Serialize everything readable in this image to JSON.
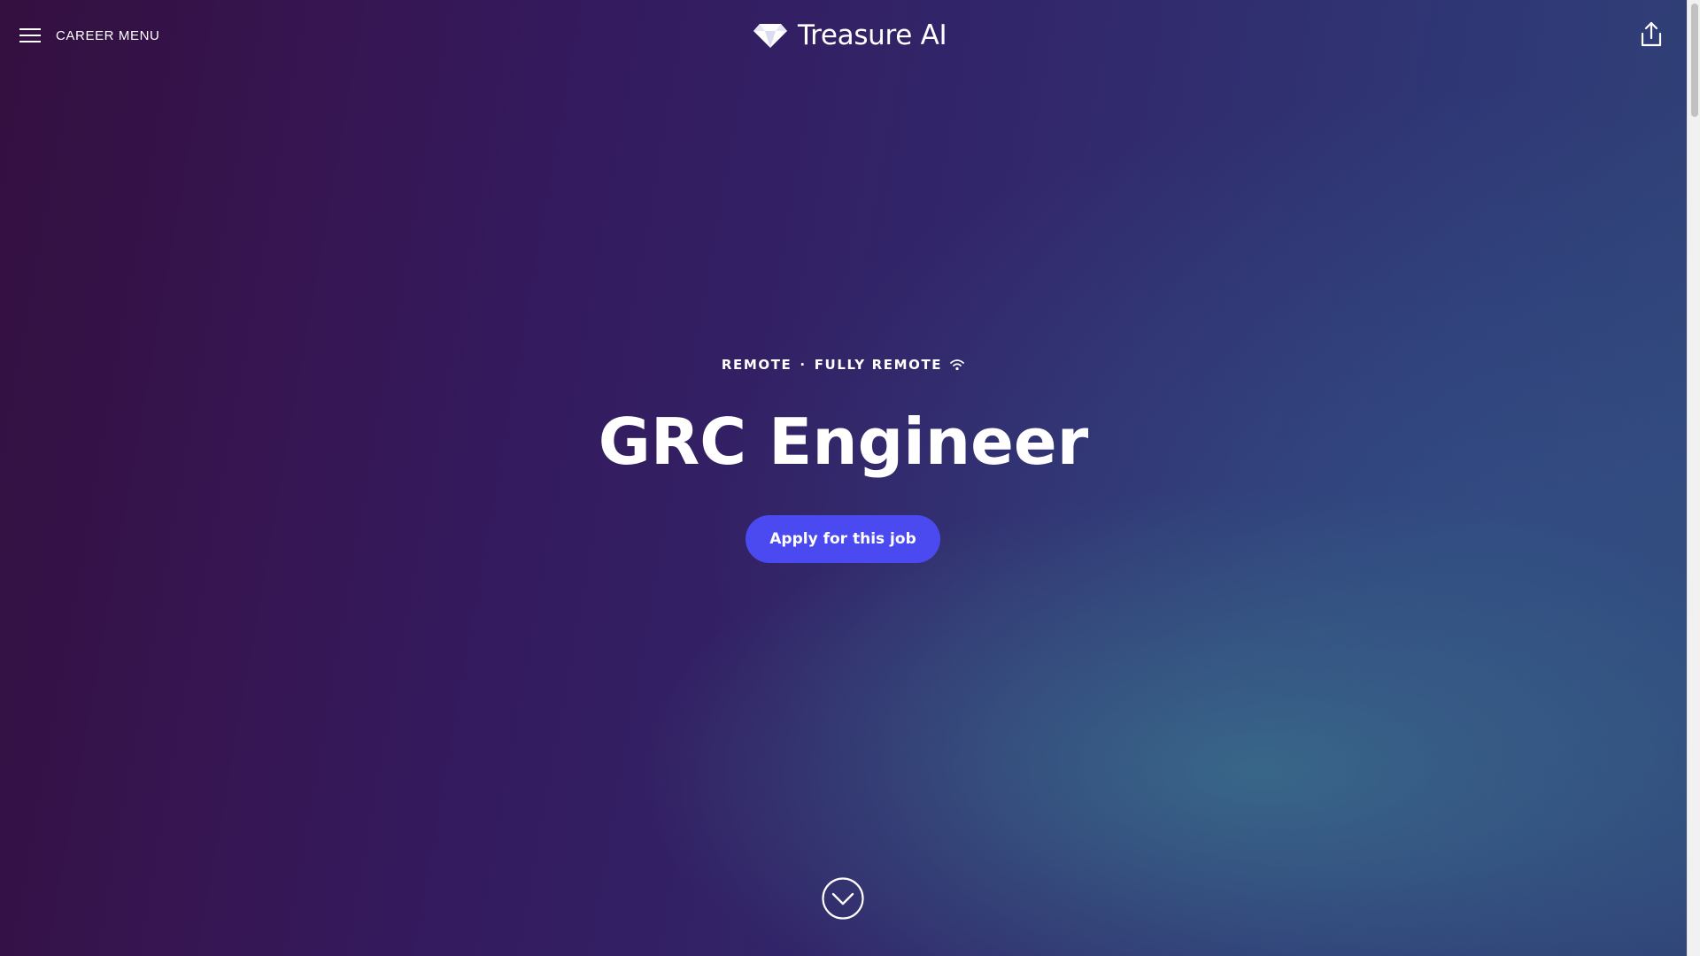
{
  "header": {
    "menu_label": "CAREER MENU",
    "brand_name": "Treasure AI"
  },
  "job": {
    "location": "REMOTE",
    "separator": "·",
    "work_type": "FULLY REMOTE",
    "title": "GRC Engineer",
    "apply_label": "Apply for this job"
  },
  "icons": {
    "menu": "hamburger-icon",
    "logo": "diamond-logo-icon",
    "share": "share-upload-icon",
    "remote": "wifi-icon",
    "scroll_down": "chevron-down-circle-icon"
  },
  "colors": {
    "apply_button": "#4a4af0",
    "background_left": "#33103f",
    "background_right": "#304478",
    "text": "#ffffff"
  }
}
